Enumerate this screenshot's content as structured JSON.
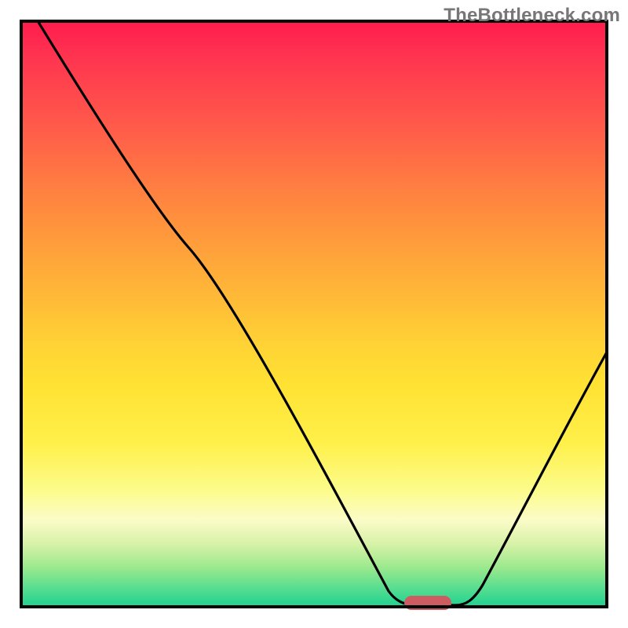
{
  "watermark": "TheBottleneck.com",
  "chart_data": {
    "type": "line",
    "title": "",
    "xlabel": "",
    "ylabel": "",
    "xlim": [
      0,
      100
    ],
    "ylim": [
      0,
      100
    ],
    "grid": false,
    "background_gradient": {
      "direction": "vertical",
      "stops": [
        {
          "pos": 0.0,
          "color": "#ff1a4d"
        },
        {
          "pos": 0.18,
          "color": "#ff5a4a"
        },
        {
          "pos": 0.45,
          "color": "#ffb338"
        },
        {
          "pos": 0.72,
          "color": "#fff04a"
        },
        {
          "pos": 0.89,
          "color": "#d8f2a8"
        },
        {
          "pos": 1.0,
          "color": "#1ad190"
        }
      ]
    },
    "series": [
      {
        "name": "bottleneck-curve",
        "color": "#000000",
        "x": [
          3,
          10,
          20,
          29,
          40,
          50,
          60,
          66,
          70,
          74,
          80,
          90,
          100
        ],
        "y": [
          100,
          82,
          67,
          61,
          44,
          28,
          10,
          1,
          0,
          1,
          10,
          28,
          44
        ]
      }
    ],
    "annotations": [
      {
        "name": "optimal-marker",
        "shape": "rounded-rect",
        "color": "#cd5c62",
        "x_range": [
          65,
          73
        ],
        "y": 0
      }
    ]
  }
}
